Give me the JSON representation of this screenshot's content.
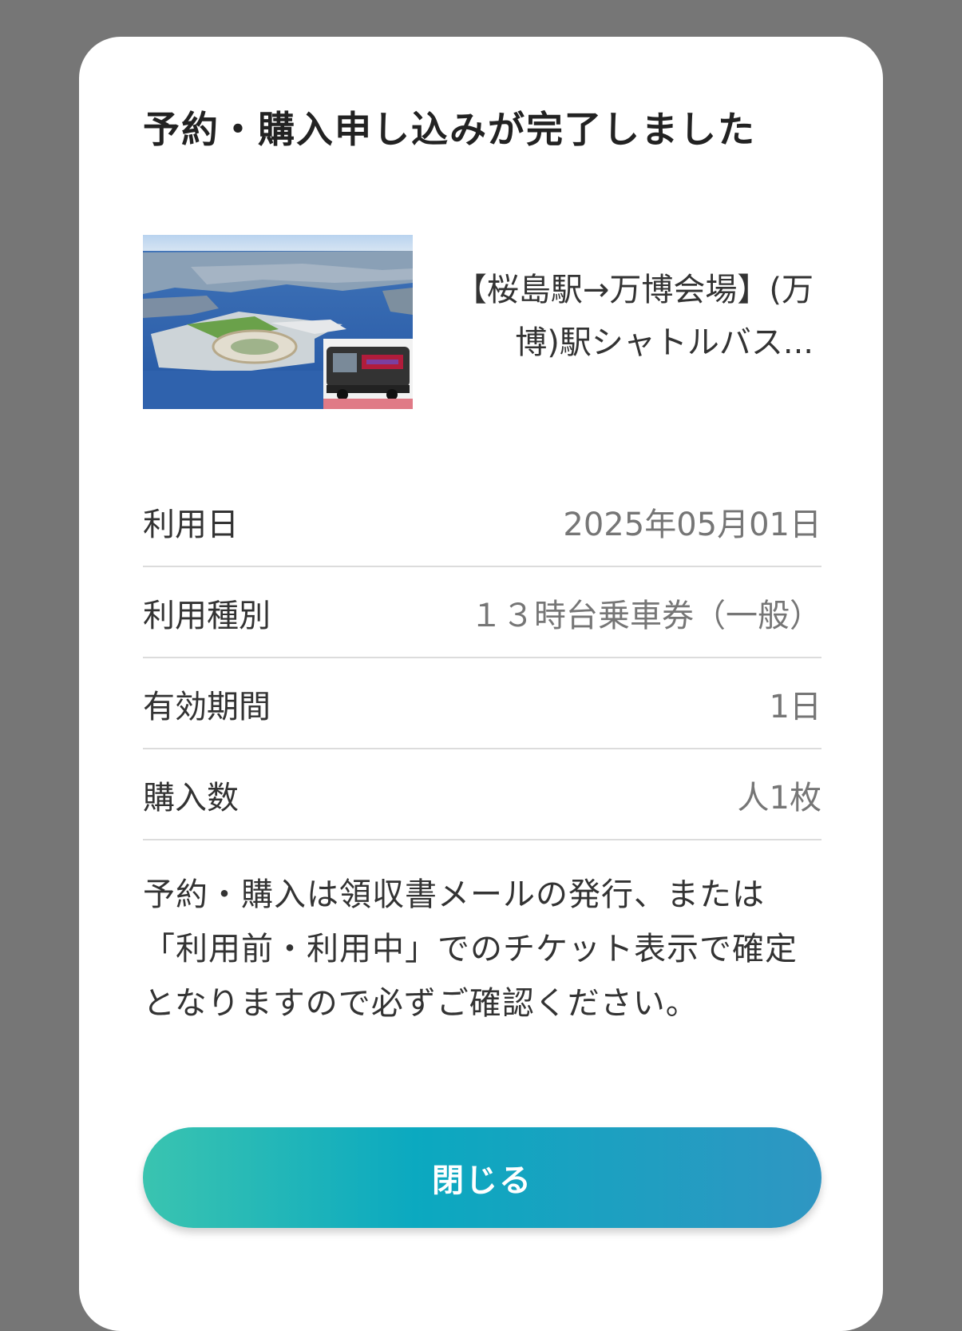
{
  "dialog": {
    "title": "予約・購入申し込みが完了しました",
    "product": {
      "image_icon": "expo-site-aerial-and-bus-photo",
      "name": "【桜島駅→万博会場】(万博)駅シャトルバス..."
    },
    "details": [
      {
        "label": "利用日",
        "value": "2025年05月01日"
      },
      {
        "label": "利用種別",
        "value": "１３時台乗車券（一般）"
      },
      {
        "label": "有効期間",
        "value": "1日"
      },
      {
        "label": "購入数",
        "value": "人1枚"
      }
    ],
    "notice": "予約・購入は領収書メールの発行、または「利用前・利用中」でのチケット表示で確定となりますので必ずご確認ください。",
    "close_label": "閉じる"
  }
}
